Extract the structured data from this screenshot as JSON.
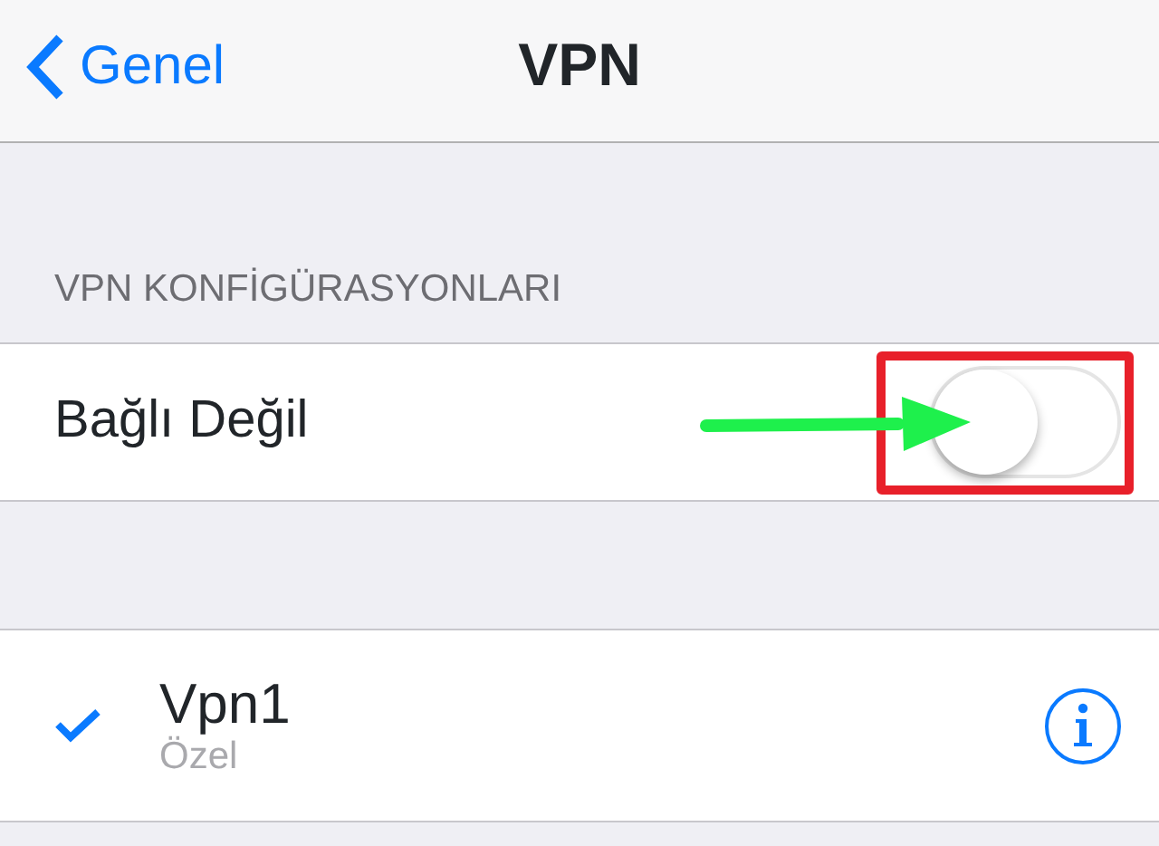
{
  "nav": {
    "back_label": "Genel",
    "title": "VPN"
  },
  "section_header": "VPN KONFİGÜRASYONLARI",
  "status_row": {
    "label": "Bağlı Değil",
    "on": false
  },
  "configurations": [
    {
      "name": "Vpn1",
      "type": "Özel",
      "selected": true
    }
  ],
  "annotations": [
    {
      "kind": "box"
    },
    {
      "kind": "arrow"
    }
  ]
}
